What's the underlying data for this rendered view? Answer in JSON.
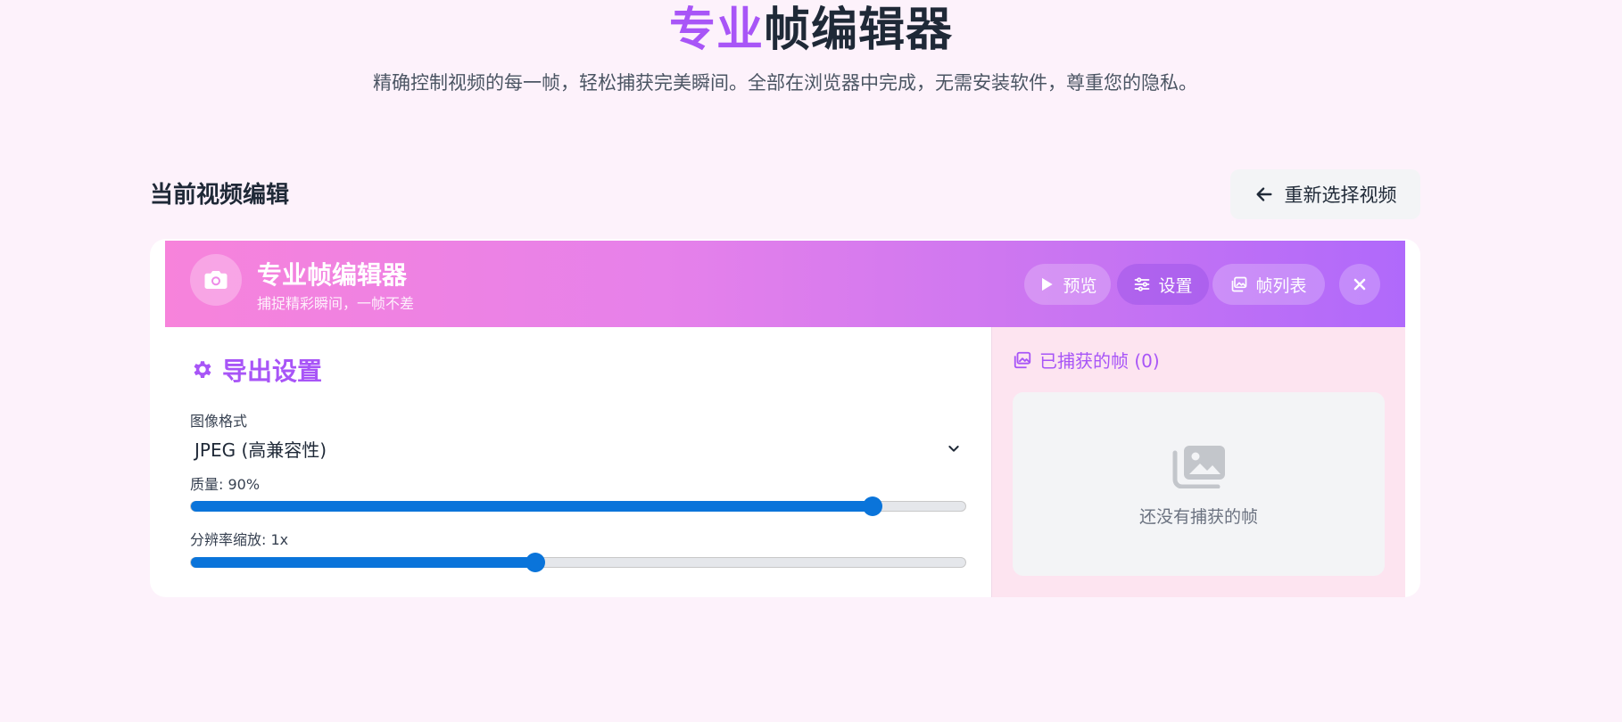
{
  "hero": {
    "title_accent": "专业",
    "title_rest": "帧编辑器",
    "subtitle": "精确控制视频的每一帧，轻松捕获完美瞬间。全部在浏览器中完成，无需安装软件，尊重您的隐私。"
  },
  "section": {
    "title": "当前视频编辑",
    "reselect_label": "重新选择视频",
    "reselect_icon": "arrow-left-icon"
  },
  "editor": {
    "header": {
      "icon": "camera-icon",
      "title": "专业帧编辑器",
      "subtitle": "捕捉精彩瞬间，一帧不差",
      "buttons": [
        {
          "label": "预览",
          "icon": "play-icon"
        },
        {
          "label": "设置",
          "icon": "sliders-icon",
          "active": true
        },
        {
          "label": "帧列表",
          "icon": "images-icon"
        }
      ],
      "close_icon": "close-icon"
    },
    "export": {
      "title": "导出设置",
      "icon": "gear-icon",
      "format_label": "图像格式",
      "format_value": "JPEG (高兼容性)",
      "quality_label": "质量: 90%",
      "quality_fraction": 0.88,
      "scale_label": "分辨率缩放: 1x",
      "scale_fraction": 0.445
    },
    "captured": {
      "title": "已捕获的帧 (0)",
      "icon": "images-icon",
      "empty_text": "还没有捕获的帧"
    }
  },
  "colors": {
    "accent": "#a855f7",
    "slider": "#0a74da",
    "background": "#fdf2fb"
  }
}
